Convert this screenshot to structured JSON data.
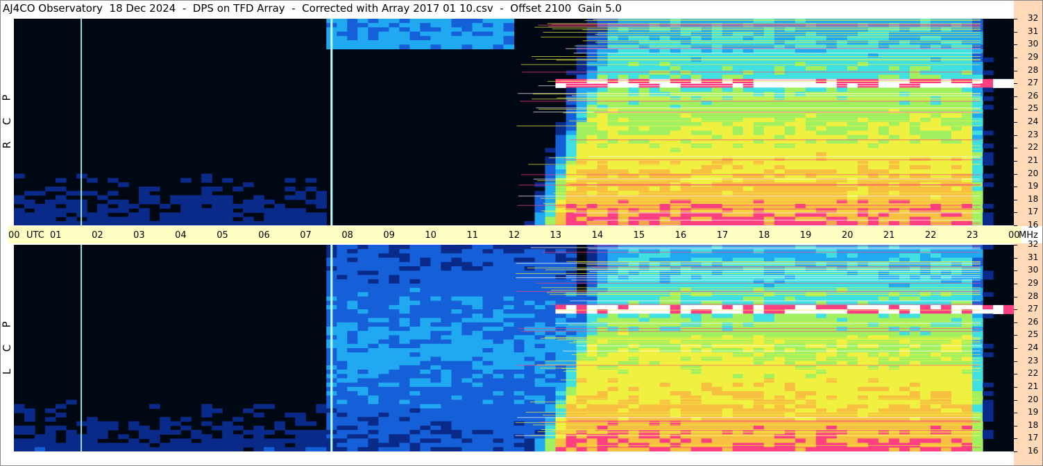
{
  "title": "AJ4CO Observatory  18 Dec 2024  -  DPS on TFD Array  -  Corrected with Array 2017 01 10.csv  -  Offset 2100  Gain 5.0",
  "chart_data": {
    "type": "heatmap",
    "title": "AJ4CO Observatory  18 Dec 2024  -  DPS on TFD Array  -  Corrected with Array 2017 01 10.csv  -  Offset 2100  Gain 5.0",
    "x_axis": {
      "unit": "UTC",
      "ticks": [
        "00",
        "01",
        "02",
        "03",
        "04",
        "05",
        "06",
        "07",
        "08",
        "09",
        "10",
        "11",
        "12",
        "13",
        "14",
        "15",
        "16",
        "17",
        "18",
        "19",
        "20",
        "21",
        "22",
        "23",
        "00"
      ],
      "range_hours": [
        0,
        24
      ]
    },
    "y_axis": {
      "unit": "MHz",
      "ticks": [
        "16",
        "17",
        "18",
        "19",
        "20",
        "21",
        "22",
        "23",
        "24",
        "25",
        "26",
        "27",
        "28",
        "29",
        "30",
        "31",
        "32"
      ],
      "range_mhz": [
        16,
        32
      ]
    },
    "panels": [
      {
        "name": "R C P",
        "polarization": [
          "R",
          "C",
          "P"
        ]
      },
      {
        "name": "L C P",
        "polarization": [
          "L",
          "C",
          "P"
        ]
      }
    ],
    "colormap": [
      "#000814",
      "#0a2a8a",
      "#1560d8",
      "#20a8f0",
      "#40e0e0",
      "#a0f060",
      "#f0f040",
      "#f8c040",
      "#ff4080",
      "#ffffff"
    ],
    "features": {
      "strong_emission_band_mhz": 27,
      "vertical_lines_utc": [
        1.6,
        7.6
      ],
      "daytime_background_utc": [
        12.3,
        23.3
      ]
    }
  },
  "labels": {
    "utc": "UTC",
    "mhz": "MHz"
  }
}
